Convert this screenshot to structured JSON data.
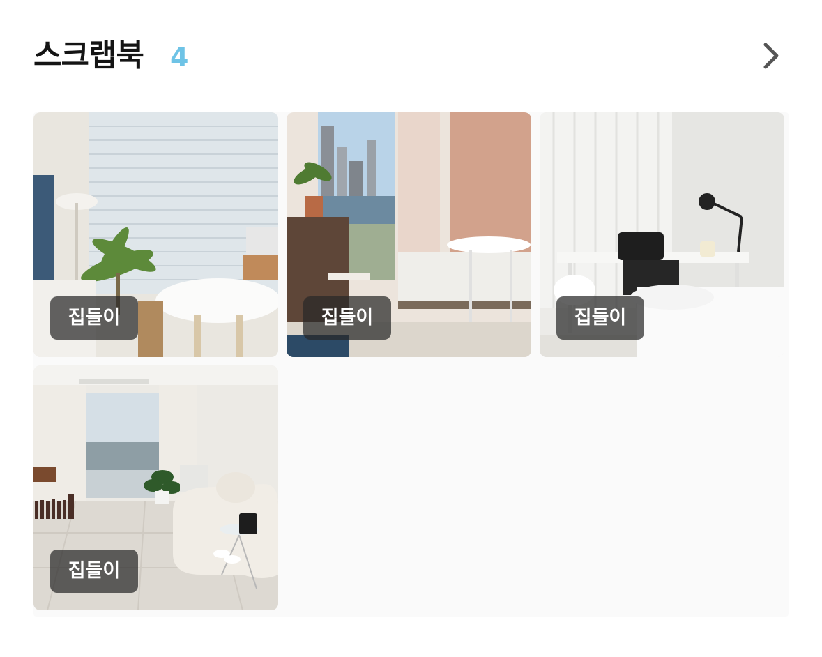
{
  "header": {
    "title": "스크랩북",
    "count": "4",
    "count_color": "#6ec3e6",
    "more_icon": "chevron-right-icon"
  },
  "scrapbook": {
    "items": [
      {
        "badge": "집들이",
        "image": "living-room-with-blinds-and-round-table"
      },
      {
        "badge": "집들이",
        "image": "bedroom-with-city-view-and-pink-wall"
      },
      {
        "badge": "집들이",
        "image": "white-room-with-desk-lamp-and-bed"
      },
      {
        "badge": "집들이",
        "image": "bright-living-room-with-sofa"
      }
    ]
  }
}
